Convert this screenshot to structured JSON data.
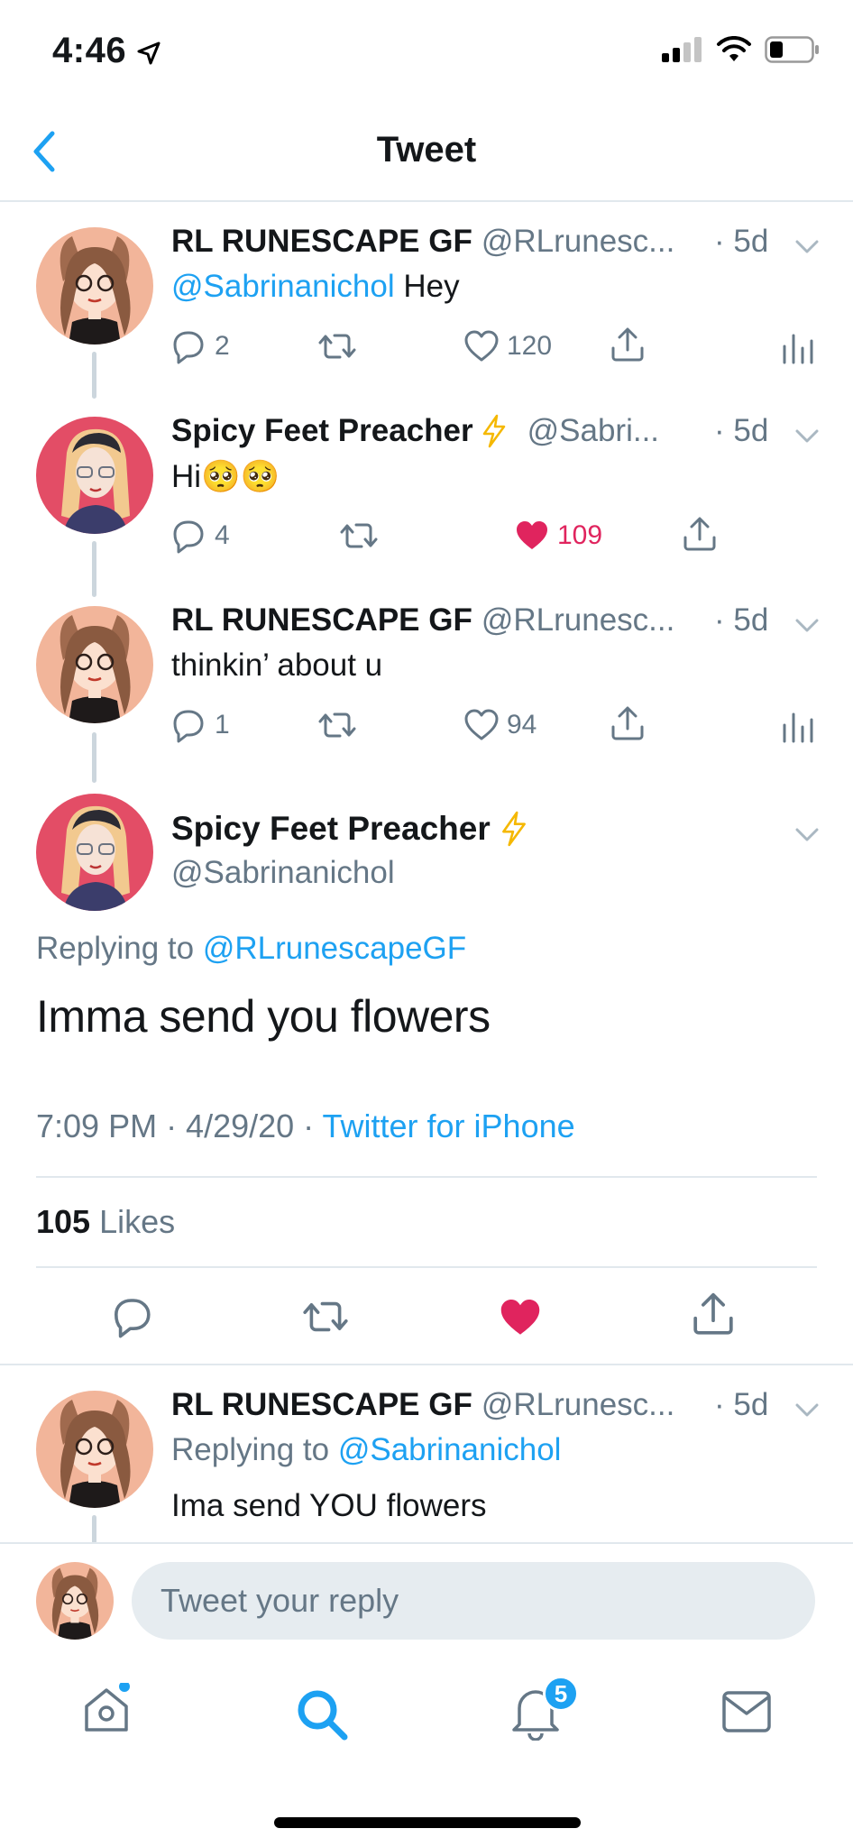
{
  "status_bar": {
    "time": "4:46"
  },
  "header": {
    "title": "Tweet"
  },
  "thread": [
    {
      "name": "RL RUNESCAPE GF",
      "handle": "@RLrunesc...",
      "time": "· 5d",
      "mention": "@Sabrinanichol",
      "text": " Hey",
      "replies": "2",
      "likes": "120",
      "liked": false
    },
    {
      "name": "Spicy Feet Preacher",
      "handle": "@Sabri...",
      "time": "· 5d",
      "text": "Hi🥺🥺",
      "replies": "4",
      "likes": "109",
      "liked": true
    },
    {
      "name": "RL RUNESCAPE GF",
      "handle": "@RLrunesc...",
      "time": "· 5d",
      "text": "thinkin’ about u",
      "replies": "1",
      "likes": "94",
      "liked": false
    }
  ],
  "focused": {
    "name": "Spicy Feet Preacher",
    "handle": "@Sabrinanichol",
    "replying_prefix": "Replying to ",
    "replying_to": "@RLrunescapeGF",
    "text": "Imma send you flowers",
    "timestamp": "7:09 PM · 4/29/20 · ",
    "source": "Twitter for iPhone",
    "likes_count": "105",
    "likes_label": "Likes"
  },
  "reply": {
    "name": "RL RUNESCAPE GF",
    "handle": "@RLrunesc...",
    "time": "· 5d",
    "replying_prefix": "Replying to ",
    "replying_to": "@Sabrinanichol",
    "text": "Ima send YOU flowers"
  },
  "composer": {
    "placeholder": "Tweet your reply"
  },
  "tabbar": {
    "notifications_badge": "5"
  },
  "colors": {
    "accent": "#1da1f2",
    "like": "#e0245e",
    "secondary": "#657786"
  }
}
